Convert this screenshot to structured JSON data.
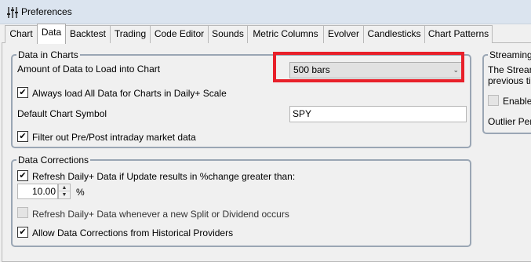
{
  "window": {
    "title": "Preferences"
  },
  "tabs": [
    {
      "label": "Chart"
    },
    {
      "label": "Data"
    },
    {
      "label": "Backtest"
    },
    {
      "label": "Trading"
    },
    {
      "label": "Code Editor"
    },
    {
      "label": "Sounds"
    },
    {
      "label": "Metric Columns"
    },
    {
      "label": "Evolver"
    },
    {
      "label": "Candlesticks"
    },
    {
      "label": "Chart Patterns"
    }
  ],
  "active_tab": "Data",
  "data_in_charts": {
    "title": "Data in Charts",
    "amount_label": "Amount of Data to Load into Chart",
    "amount_value": "500 bars",
    "always_load_label": "Always load All Data for Charts in Daily+ Scale",
    "always_load_checked": true,
    "default_symbol_label": "Default Chart Symbol",
    "default_symbol_value": "SPY",
    "filter_prepost_label": "Filter out Pre/Post intraday market data",
    "filter_prepost_checked": true
  },
  "data_corrections": {
    "title": "Data Corrections",
    "refresh_pct_label": "Refresh Daily+ Data if Update results in %change greater than:",
    "refresh_pct_checked": true,
    "pct_value": "10.00",
    "pct_unit": "%",
    "refresh_split_label": "Refresh Daily+ Data whenever a new Split or Dividend occurs",
    "refresh_split_checked": false,
    "allow_corrections_label": "Allow Data Corrections from Historical Providers",
    "allow_corrections_checked": true
  },
  "streaming": {
    "title": "Streaming",
    "line1": "The Stream",
    "line2": "previous ti",
    "enable_label": "Enable",
    "enable_checked": false,
    "outlier_label": "Outlier Per"
  },
  "check_glyph": "✔",
  "colors": {
    "highlight": "#e8202a",
    "titlebar": "#dbe4ef"
  }
}
